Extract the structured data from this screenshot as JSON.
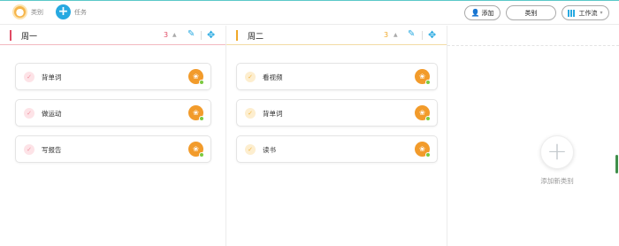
{
  "toolbar": {
    "category_label": "类别",
    "task_label": "任务",
    "category_icon": "category-icon",
    "task_icon": "plus-icon",
    "add_label": "添加",
    "category_button_label": "类别",
    "workflow_label": "工作流"
  },
  "columns": [
    {
      "title": "周一",
      "count": "3",
      "accent": "#e04b64",
      "cards": [
        {
          "label": "背单词"
        },
        {
          "label": "做运动"
        },
        {
          "label": "写报告"
        }
      ]
    },
    {
      "title": "周二",
      "count": "3",
      "accent": "#f0a828",
      "cards": [
        {
          "label": "看视频"
        },
        {
          "label": "背单词"
        },
        {
          "label": "读书"
        }
      ]
    }
  ],
  "add_category": {
    "label": "添加新类别"
  },
  "colors": {
    "primary": "#27a9e1",
    "avatar": "#f29b2b",
    "online": "#7bc93f"
  }
}
